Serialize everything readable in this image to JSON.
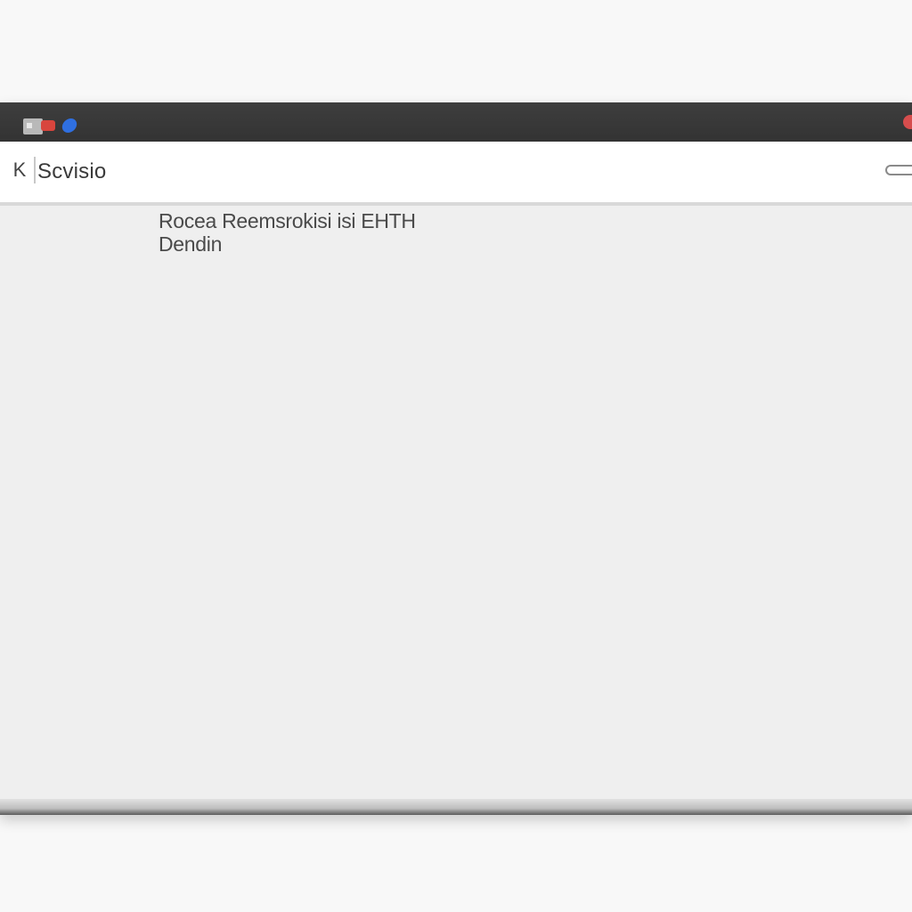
{
  "window": {
    "title_icons": [
      "window-icon",
      "red-indicator-icon",
      "blue-dot-icon"
    ]
  },
  "header": {
    "close_glyph": "K",
    "title": "Scvisio",
    "menu_icon": "menu-icon"
  },
  "content": {
    "line1": "Rocea Reemsrokisi isi EHTH",
    "line2": "Dendin"
  },
  "colors": {
    "titlebar": "#363636",
    "accent_red": "#d8453d",
    "accent_blue": "#2f6fe0",
    "content_bg": "#efefef"
  }
}
